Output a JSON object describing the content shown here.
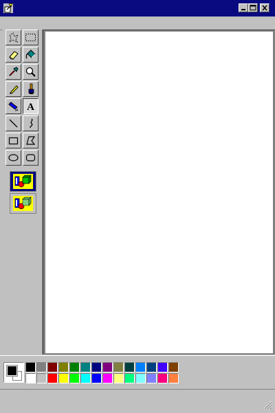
{
  "window": {
    "title": "",
    "status_text": "",
    "controls": [
      "minimize-icon",
      "maximize-icon",
      "close-icon"
    ]
  },
  "tools": [
    {
      "id": "free-form-select",
      "icon": "free-form-select-icon",
      "active": false
    },
    {
      "id": "select",
      "icon": "rectangle-select-icon",
      "active": false
    },
    {
      "id": "eraser",
      "icon": "eraser-icon",
      "active": false
    },
    {
      "id": "fill",
      "icon": "paint-bucket-icon",
      "active": false
    },
    {
      "id": "pick-color",
      "icon": "eyedropper-icon",
      "active": false
    },
    {
      "id": "magnifier",
      "icon": "magnifier-icon",
      "active": false
    },
    {
      "id": "pencil",
      "icon": "pencil-icon",
      "active": false
    },
    {
      "id": "brush",
      "icon": "brush-icon",
      "active": false
    },
    {
      "id": "airbrush",
      "icon": "airbrush-icon",
      "active": false
    },
    {
      "id": "text",
      "icon": "text-icon",
      "label": "A",
      "active": true
    },
    {
      "id": "line",
      "icon": "line-icon",
      "active": false
    },
    {
      "id": "curve",
      "icon": "curve-icon",
      "active": false
    },
    {
      "id": "rectangle",
      "icon": "rectangle-icon",
      "active": false
    },
    {
      "id": "polygon",
      "icon": "polygon-icon",
      "active": false
    },
    {
      "id": "ellipse",
      "icon": "ellipse-icon",
      "active": false
    },
    {
      "id": "rounded-rectangle",
      "icon": "rounded-rectangle-icon",
      "active": false
    }
  ],
  "text_options": [
    {
      "id": "opaque",
      "icon": "opaque-background-icon",
      "selected": true
    },
    {
      "id": "transparent",
      "icon": "transparent-background-icon",
      "selected": false
    }
  ],
  "current_colors": {
    "foreground": "#000000",
    "background": "#ffffff"
  },
  "palette": {
    "row1": [
      "#000000",
      "#808080",
      "#800000",
      "#808000",
      "#008000",
      "#008080",
      "#000080",
      "#800080",
      "#808040",
      "#004040",
      "#0080ff",
      "#004080",
      "#4000ff",
      "#804000"
    ],
    "row2": [
      "#ffffff",
      "#c0c0c0",
      "#ff0000",
      "#ffff00",
      "#00ff00",
      "#00ffff",
      "#0000ff",
      "#ff00ff",
      "#ffff80",
      "#00ff80",
      "#80ffff",
      "#8080ff",
      "#ff0080",
      "#ff8040"
    ]
  }
}
